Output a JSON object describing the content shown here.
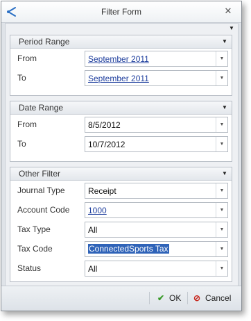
{
  "window": {
    "title": "Filter Form",
    "close_glyph": "✕"
  },
  "icons": {
    "app": "app-logo-icon",
    "collapse": "collapse-arrow-icon",
    "dropdown": "chevron-down-icon"
  },
  "period_range": {
    "header": "Period Range",
    "from": {
      "label": "From",
      "value": "September 2011"
    },
    "to": {
      "label": "To",
      "value": "September 2011"
    }
  },
  "date_range": {
    "header": "Date Range",
    "from": {
      "label": "From",
      "value": "8/5/2012"
    },
    "to": {
      "label": "To",
      "value": "10/7/2012"
    }
  },
  "other_filter": {
    "header": "Other Filter",
    "journal_type": {
      "label": "Journal Type",
      "value": "Receipt"
    },
    "account_code": {
      "label": "Account Code",
      "value": "1000"
    },
    "tax_type": {
      "label": "Tax Type",
      "value": "All"
    },
    "tax_code": {
      "label": "Tax Code",
      "value": "ConnectedSports Tax"
    },
    "status": {
      "label": "Status",
      "value": "All"
    }
  },
  "footer": {
    "ok_label": "OK",
    "cancel_label": "Cancel"
  },
  "colors": {
    "ok_icon": "#3a9a2a",
    "cancel_icon": "#c8281e",
    "link": "#1f3f9e",
    "selection": "#2f63b8"
  }
}
